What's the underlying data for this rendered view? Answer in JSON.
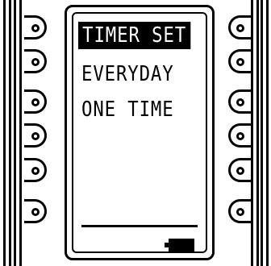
{
  "screen": {
    "menu": [
      {
        "label": "TIMER SET",
        "selected": true
      },
      {
        "label": "EVERYDAY",
        "selected": false
      },
      {
        "label": "ONE TIME",
        "selected": false
      }
    ],
    "battery_icon": "battery-full-icon"
  },
  "soft_keys": {
    "left_count": 6,
    "right_count": 6
  },
  "colors": {
    "foreground": "#000000",
    "background": "#ffffff"
  }
}
